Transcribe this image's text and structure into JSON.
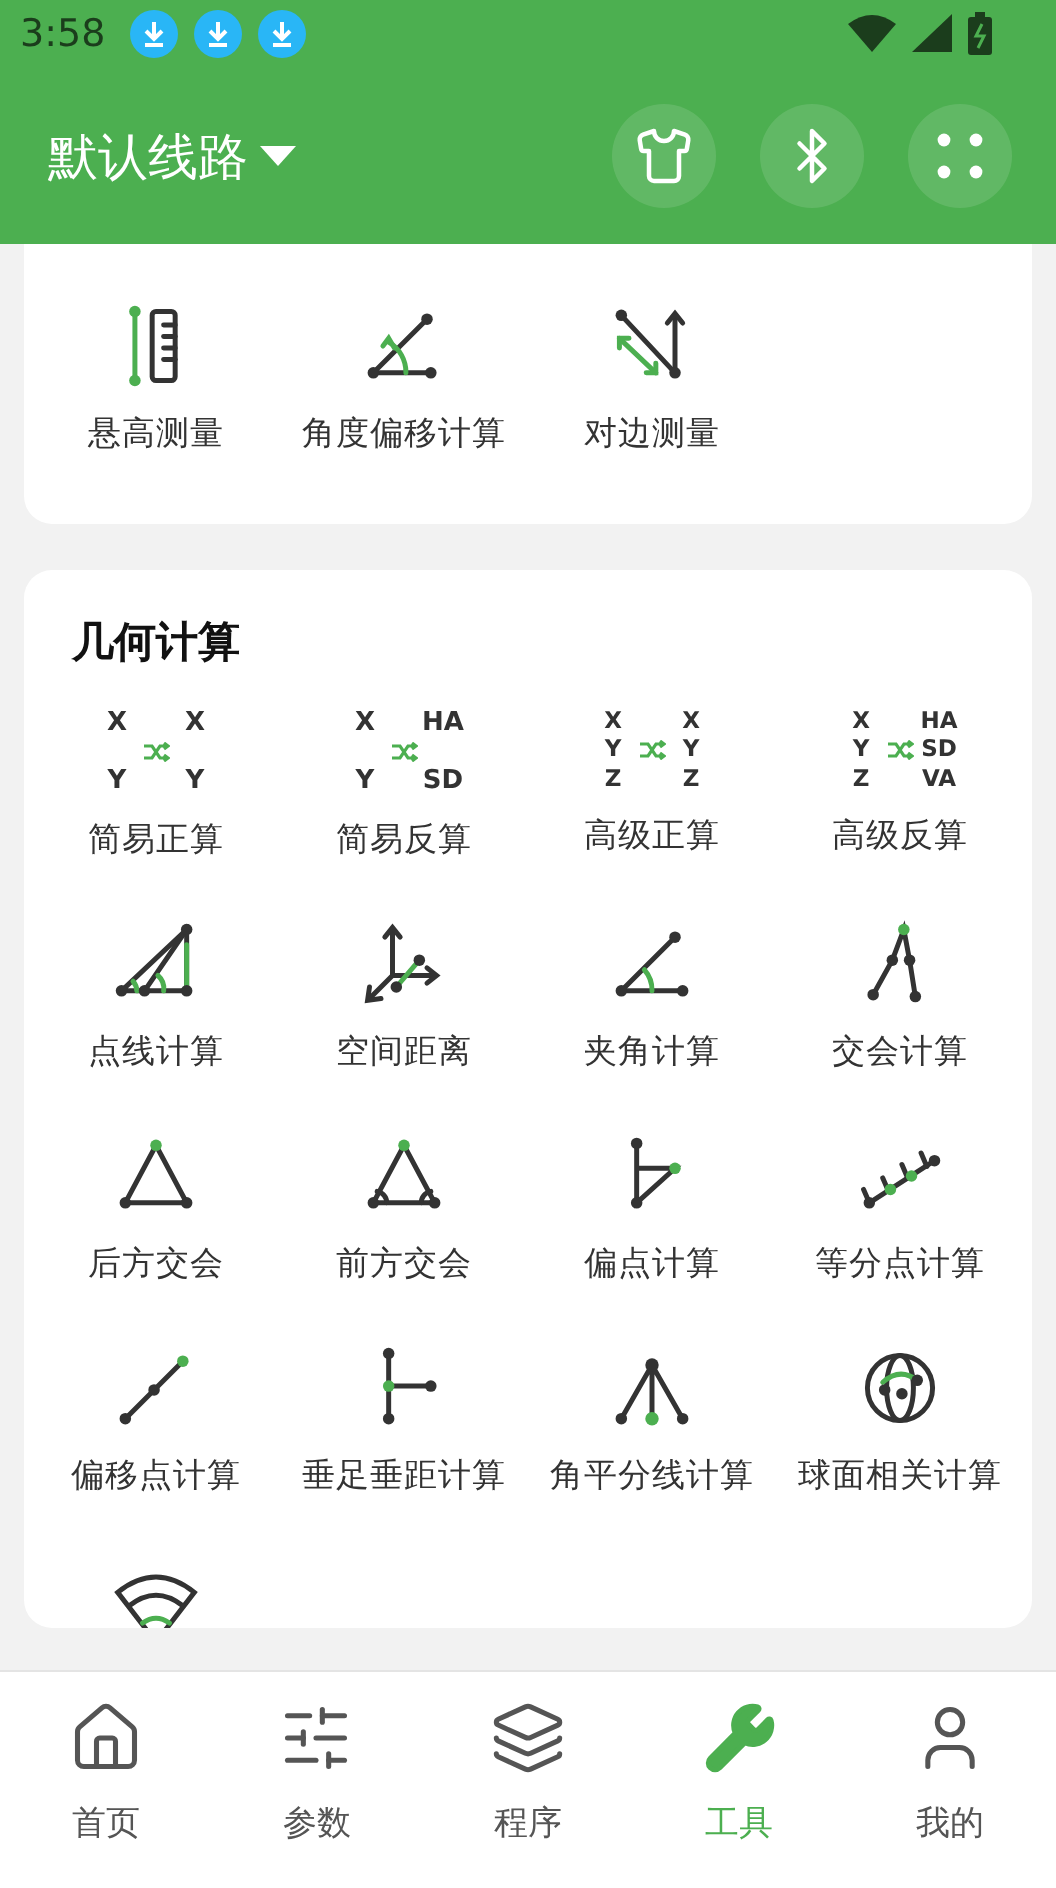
{
  "status_bar": {
    "time": "3:58",
    "notifications": [
      {
        "kind": "download"
      },
      {
        "kind": "download"
      },
      {
        "kind": "download"
      }
    ]
  },
  "header": {
    "title": "默认线路",
    "actions": [
      {
        "kind": "shirt"
      },
      {
        "kind": "bluetooth"
      },
      {
        "kind": "dots"
      }
    ]
  },
  "measure_card": {
    "items": [
      {
        "kind": "height",
        "label": "悬高测量"
      },
      {
        "kind": "angle-offset",
        "label": "角度偏移计算"
      },
      {
        "kind": "opposite",
        "label": "对边测量"
      }
    ]
  },
  "geometry_card": {
    "title": "几何计算",
    "items": [
      {
        "kind": "coords",
        "left": [
          "X",
          "Y"
        ],
        "right": [
          "X",
          "Y"
        ],
        "label": "简易正算"
      },
      {
        "kind": "coords",
        "left": [
          "X",
          "Y"
        ],
        "right": [
          "HA",
          "SD"
        ],
        "label": "简易反算"
      },
      {
        "kind": "coords",
        "left": [
          "X",
          "Y",
          "Z"
        ],
        "right": [
          "X",
          "Y",
          "Z"
        ],
        "label": "高级正算"
      },
      {
        "kind": "coords",
        "left": [
          "X",
          "Y",
          "Z"
        ],
        "right": [
          "HA",
          "SD",
          "VA"
        ],
        "label": "高级反算"
      },
      {
        "kind": "point-line",
        "label": "点线计算"
      },
      {
        "kind": "space",
        "label": "空间距离"
      },
      {
        "kind": "included-angle",
        "label": "夹角计算"
      },
      {
        "kind": "intersection",
        "label": "交会计算"
      },
      {
        "kind": "resection",
        "label": "后方交会"
      },
      {
        "kind": "forward",
        "label": "前方交会"
      },
      {
        "kind": "offset-point",
        "label": "偏点计算"
      },
      {
        "kind": "division",
        "label": "等分点计算"
      },
      {
        "kind": "offset-line",
        "label": "偏移点计算"
      },
      {
        "kind": "perpendicular",
        "label": "垂足垂距计算"
      },
      {
        "kind": "bisector",
        "label": "角平分线计算"
      },
      {
        "kind": "sphere",
        "label": "球面相关计算"
      },
      {
        "kind": "sector"
      }
    ]
  },
  "bottom_nav": [
    {
      "kind": "home",
      "label": "首页",
      "selected": false
    },
    {
      "kind": "params",
      "label": "参数",
      "selected": false
    },
    {
      "kind": "layers",
      "label": "程序",
      "selected": false
    },
    {
      "kind": "tools",
      "label": "工具",
      "selected": true
    },
    {
      "kind": "user",
      "label": "我的",
      "selected": false
    }
  ]
}
